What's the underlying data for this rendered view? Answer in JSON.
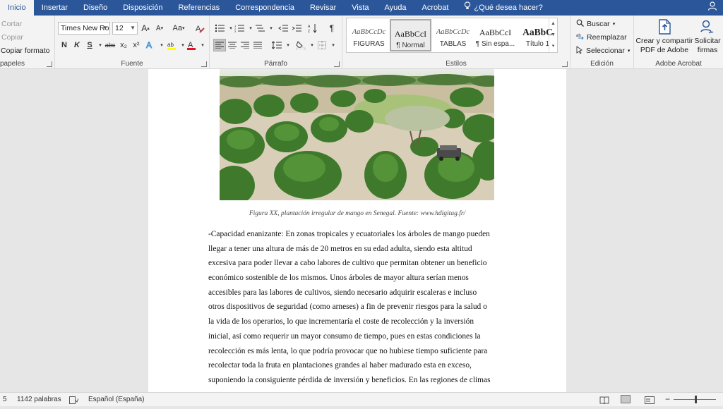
{
  "tabs": [
    "Inicio",
    "Insertar",
    "Diseño",
    "Disposición",
    "Referencias",
    "Correspondencia",
    "Revisar",
    "Vista",
    "Ayuda",
    "Acrobat"
  ],
  "tell_me": "¿Qué desea hacer?",
  "clipboard": {
    "cut": "Cortar",
    "copy": "Copiar",
    "format_painter": "Copiar formato",
    "label": "papeles"
  },
  "font": {
    "name": "Times New Ro",
    "size": "12",
    "label": "Fuente",
    "bold": "N",
    "italic": "K",
    "underline": "S",
    "strike": "abc",
    "subscript": "x₂",
    "superscript": "x²",
    "grow": "A",
    "shrink": "A",
    "case": "Aa"
  },
  "paragraph": {
    "label": "Párrafo"
  },
  "styles": {
    "label": "Estilos",
    "items": [
      {
        "preview": "AaBbCcDc",
        "name": "FIGURAS"
      },
      {
        "preview": "AaBbCcI",
        "name": "¶ Normal"
      },
      {
        "preview": "AaBbCcDc",
        "name": "TABLAS"
      },
      {
        "preview": "AaBbCcI",
        "name": "¶ Sin espa..."
      },
      {
        "preview": "AaBbC",
        "name": "Título 1"
      }
    ]
  },
  "editing": {
    "label": "Edición",
    "find": "Buscar",
    "replace": "Reemplazar",
    "select": "Seleccionar"
  },
  "acrobat": {
    "label": "Adobe Acrobat",
    "create_line1": "Crear y compartir",
    "create_line2": "PDF de Adobe",
    "sign_line1": "Solicitar",
    "sign_line2": "firmas"
  },
  "document": {
    "caption": "Figura XX, plantación irregular de mango en Senegal. Fuente: www.hdigitag.fr/",
    "lines": [
      "-Capacidad enanizante: En zonas tropicales y ecuatoriales los árboles de mango pueden",
      "llegar a tener una altura de más de 20 metros en su edad adulta, siendo esta altitud",
      "excesiva para poder llevar a cabo labores de cultivo que permitan obtener un beneficio",
      "económico sostenible de los mismos. Unos árboles de mayor altura serían menos",
      "accesibles para las labores de cultivos, siendo necesario adquirir escaleras e incluso",
      "otros dispositivos de seguridad (como arneses) a fin de prevenir riesgos para la salud o",
      "la vida de los operarios, lo que incrementaría el coste de recolección y la inversión",
      "inicial, así como requerir un mayor consumo de tiempo, pues en estas condiciones la",
      "recolección es más lenta, lo que podría provocar que no hubiese tiempo suficiente para",
      "recolectar toda la fruta en plantaciones grandes al haber madurado esta en exceso,",
      "suponiendo la consiguiente pérdida de inversión y beneficios.  En las regiones de climas"
    ]
  },
  "status": {
    "page": "5",
    "words": "1142 palabras",
    "language": "Español (España)"
  },
  "colors": {
    "word_blue": "#2b579a",
    "ribbon_bg": "#f3f3f3",
    "highlight_yellow": "#ffff00",
    "font_color_red": "#e81123"
  }
}
